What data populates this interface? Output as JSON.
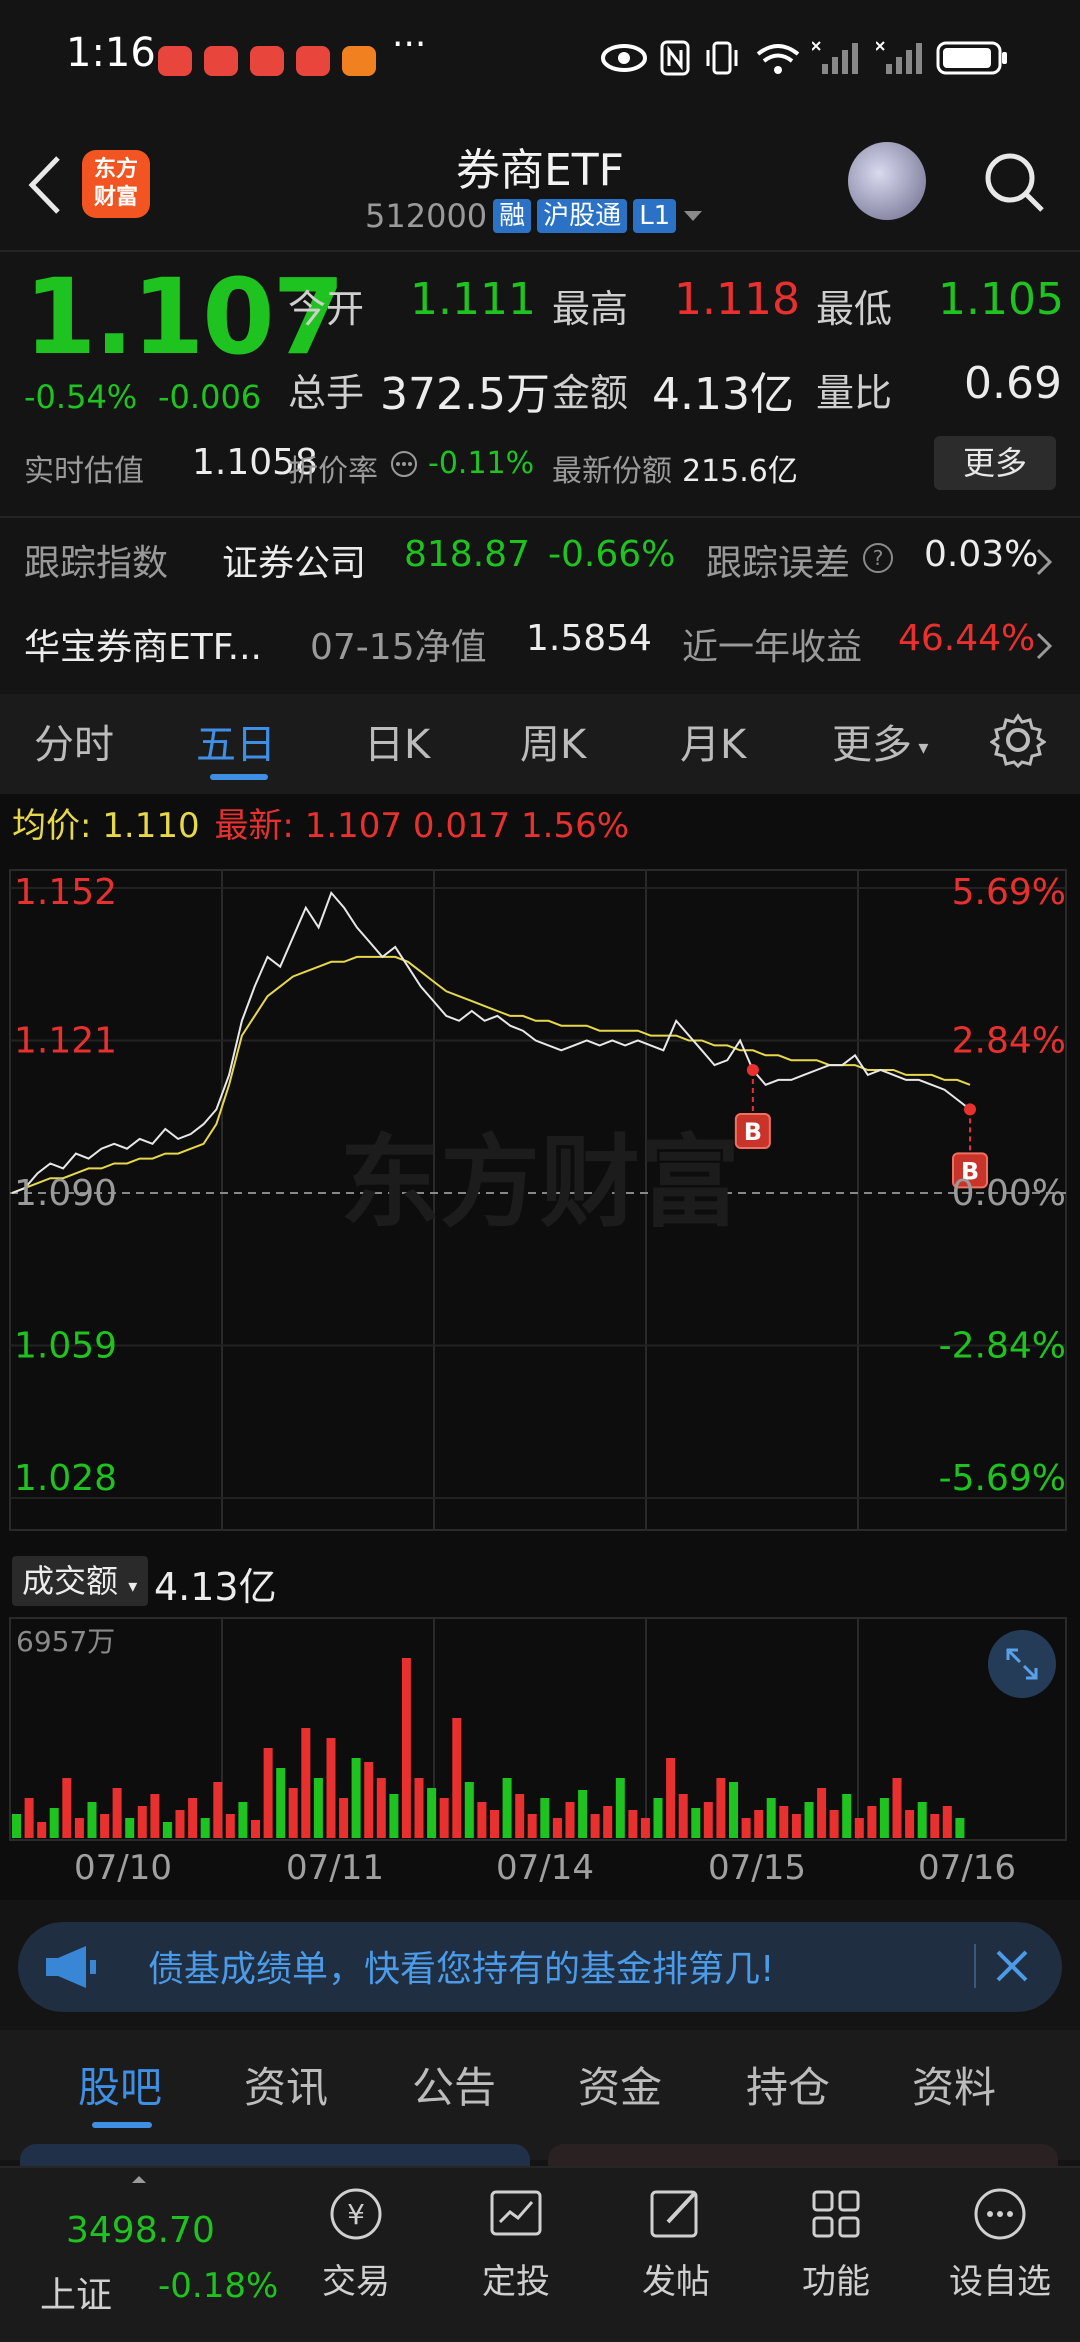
{
  "status_bar": {
    "time": "1:16",
    "more": "···"
  },
  "header": {
    "logo_line1": "东方",
    "logo_line2": "财富",
    "title": "券商ETF",
    "code": "512000",
    "tags": [
      "融",
      "沪股通",
      "L1"
    ]
  },
  "quote": {
    "price": "1.107",
    "change_pct": "-0.54%",
    "change_abs": "-0.006",
    "open_label": "今开",
    "open": "1.111",
    "high_label": "最高",
    "high": "1.118",
    "low_label": "最低",
    "low": "1.105",
    "volume_label": "总手",
    "volume": "372.5万",
    "amount_label": "金额",
    "amount": "4.13亿",
    "ratio_label": "量比",
    "ratio": "0.69",
    "iopv_label": "实时估值",
    "iopv": "1.1058",
    "discount_label": "折价率",
    "discount": "-0.11%",
    "shares_label": "最新份额",
    "shares": "215.6亿",
    "more_button": "更多"
  },
  "tracking": {
    "index_label": "跟踪指数",
    "index_name": "证券公司",
    "index_value": "818.87",
    "index_change": "-0.66%",
    "error_label": "跟踪误差",
    "error_value": "0.03%"
  },
  "fund": {
    "name": "华宝券商ETF...",
    "nav_label": "07-15净值",
    "nav_value": "1.5854",
    "return_label": "近一年收益",
    "return_value": "46.44%"
  },
  "chart_tabs": [
    "分时",
    "五日",
    "日K",
    "周K",
    "月K",
    "更多"
  ],
  "active_chart_tab": "五日",
  "legend": {
    "avg_label": "均价:",
    "avg_value": "1.110",
    "latest_label": "最新:",
    "latest_value": "1.107",
    "latest_change": "0.017",
    "latest_pct": "1.56%"
  },
  "chart_data": {
    "type": "line",
    "title": "",
    "x": [
      "07/10",
      "07/11",
      "07/14",
      "07/15",
      "07/16"
    ],
    "ylim": [
      1.028,
      1.152
    ],
    "y_ticks_left": [
      "1.152",
      "1.121",
      "1.090",
      "1.059",
      "1.028"
    ],
    "y_ticks_right": [
      "5.69%",
      "2.84%",
      "0.00%",
      "-2.84%",
      "-5.69%"
    ],
    "series": [
      {
        "name": "最新",
        "color": "#e8e8e8"
      },
      {
        "name": "均价",
        "color": "#e6d84a"
      }
    ],
    "price_series": [
      1.09,
      1.091,
      1.094,
      1.096,
      1.095,
      1.098,
      1.097,
      1.099,
      1.1,
      1.099,
      1.101,
      1.1,
      1.103,
      1.101,
      1.102,
      1.104,
      1.107,
      1.114,
      1.125,
      1.132,
      1.138,
      1.136,
      1.142,
      1.148,
      1.144,
      1.151,
      1.148,
      1.144,
      1.141,
      1.138,
      1.14,
      1.136,
      1.132,
      1.129,
      1.126,
      1.125,
      1.127,
      1.125,
      1.126,
      1.124,
      1.123,
      1.121,
      1.12,
      1.119,
      1.12,
      1.121,
      1.12,
      1.121,
      1.12,
      1.121,
      1.12,
      1.119,
      1.125,
      1.122,
      1.119,
      1.116,
      1.117,
      1.121,
      1.115,
      1.112,
      1.113,
      1.113,
      1.114,
      1.115,
      1.116,
      1.116,
      1.118,
      1.114,
      1.115,
      1.114,
      1.113,
      1.113,
      1.112,
      1.111,
      1.109,
      1.107
    ],
    "avg_series": [
      1.09,
      1.091,
      1.092,
      1.093,
      1.093,
      1.094,
      1.095,
      1.095,
      1.096,
      1.096,
      1.097,
      1.097,
      1.098,
      1.098,
      1.099,
      1.1,
      1.104,
      1.112,
      1.122,
      1.126,
      1.13,
      1.132,
      1.134,
      1.135,
      1.136,
      1.137,
      1.137,
      1.138,
      1.138,
      1.138,
      1.138,
      1.137,
      1.135,
      1.133,
      1.131,
      1.13,
      1.129,
      1.128,
      1.127,
      1.126,
      1.126,
      1.125,
      1.125,
      1.124,
      1.124,
      1.124,
      1.123,
      1.123,
      1.123,
      1.123,
      1.122,
      1.122,
      1.122,
      1.121,
      1.121,
      1.12,
      1.12,
      1.119,
      1.119,
      1.118,
      1.118,
      1.117,
      1.117,
      1.117,
      1.116,
      1.116,
      1.116,
      1.115,
      1.115,
      1.115,
      1.114,
      1.114,
      1.114,
      1.113,
      1.113,
      1.112
    ],
    "markers": [
      {
        "label": "B",
        "index": 58
      },
      {
        "label": "B",
        "index": 75
      }
    ],
    "watermark": "东方财富"
  },
  "volume": {
    "button": "成交额",
    "total": "4.13亿",
    "max_label": "6957万",
    "bars": [
      0.12,
      0.2,
      0.08,
      0.15,
      0.3,
      0.1,
      0.18,
      0.12,
      0.25,
      0.1,
      0.16,
      0.22,
      0.08,
      0.14,
      0.2,
      0.1,
      0.28,
      0.12,
      0.18,
      0.09,
      0.45,
      0.35,
      0.25,
      0.55,
      0.3,
      0.5,
      0.2,
      0.4,
      0.38,
      0.3,
      0.22,
      0.9,
      0.3,
      0.25,
      0.2,
      0.6,
      0.28,
      0.18,
      0.14,
      0.3,
      0.22,
      0.12,
      0.2,
      0.1,
      0.18,
      0.24,
      0.12,
      0.16,
      0.3,
      0.14,
      0.1,
      0.2,
      0.4,
      0.22,
      0.15,
      0.18,
      0.3,
      0.28,
      0.1,
      0.14,
      0.2,
      0.16,
      0.12,
      0.18,
      0.25,
      0.14,
      0.22,
      0.1,
      0.16,
      0.2,
      0.3,
      0.14,
      0.18,
      0.12,
      0.16,
      0.1
    ]
  },
  "banner": {
    "text": "债基成绩单，快看您持有的基金排第几!"
  },
  "sub_tabs": [
    "股吧",
    "资讯",
    "公告",
    "资金",
    "持仓",
    "资料"
  ],
  "active_sub_tab": "股吧",
  "bottom_nav": {
    "index_value": "3498.70",
    "index_name": "上证",
    "index_change": "-0.18%",
    "items": [
      "交易",
      "定投",
      "发帖",
      "功能",
      "设自选"
    ]
  }
}
